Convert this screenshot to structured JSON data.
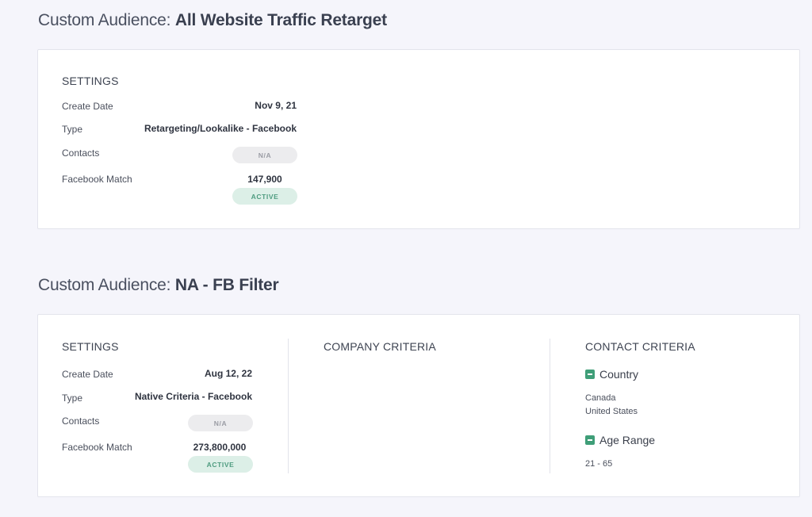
{
  "audiences": [
    {
      "title_prefix": "Custom Audience: ",
      "title_name": "All Website Traffic Retarget",
      "settings": {
        "heading": "SETTINGS",
        "create_date_label": "Create Date",
        "create_date": "Nov 9, 21",
        "type_label": "Type",
        "type": "Retargeting/Lookalike - Facebook",
        "contacts_label": "Contacts",
        "contacts_badge": "N/A",
        "fb_match_label": "Facebook Match",
        "fb_match": "147,900",
        "status_badge": "ACTIVE"
      }
    },
    {
      "title_prefix": "Custom Audience: ",
      "title_name": "NA - FB Filter",
      "settings": {
        "heading": "SETTINGS",
        "create_date_label": "Create Date",
        "create_date": "Aug 12, 22",
        "type_label": "Type",
        "type": "Native Criteria - Facebook",
        "contacts_label": "Contacts",
        "contacts_badge": "N/A",
        "fb_match_label": "Facebook Match",
        "fb_match": "273,800,000",
        "status_badge": "ACTIVE"
      },
      "company_criteria": {
        "heading": "COMPANY CRITERIA"
      },
      "contact_criteria": {
        "heading": "CONTACT CRITERIA",
        "country_label": "Country",
        "countries": [
          "Canada",
          "United States"
        ],
        "age_label": "Age Range",
        "age_value": "21 - 65"
      }
    }
  ],
  "colors": {
    "accent_green": "#3f9e78",
    "active_bg": "#dcefe7",
    "na_bg": "#ececee"
  }
}
